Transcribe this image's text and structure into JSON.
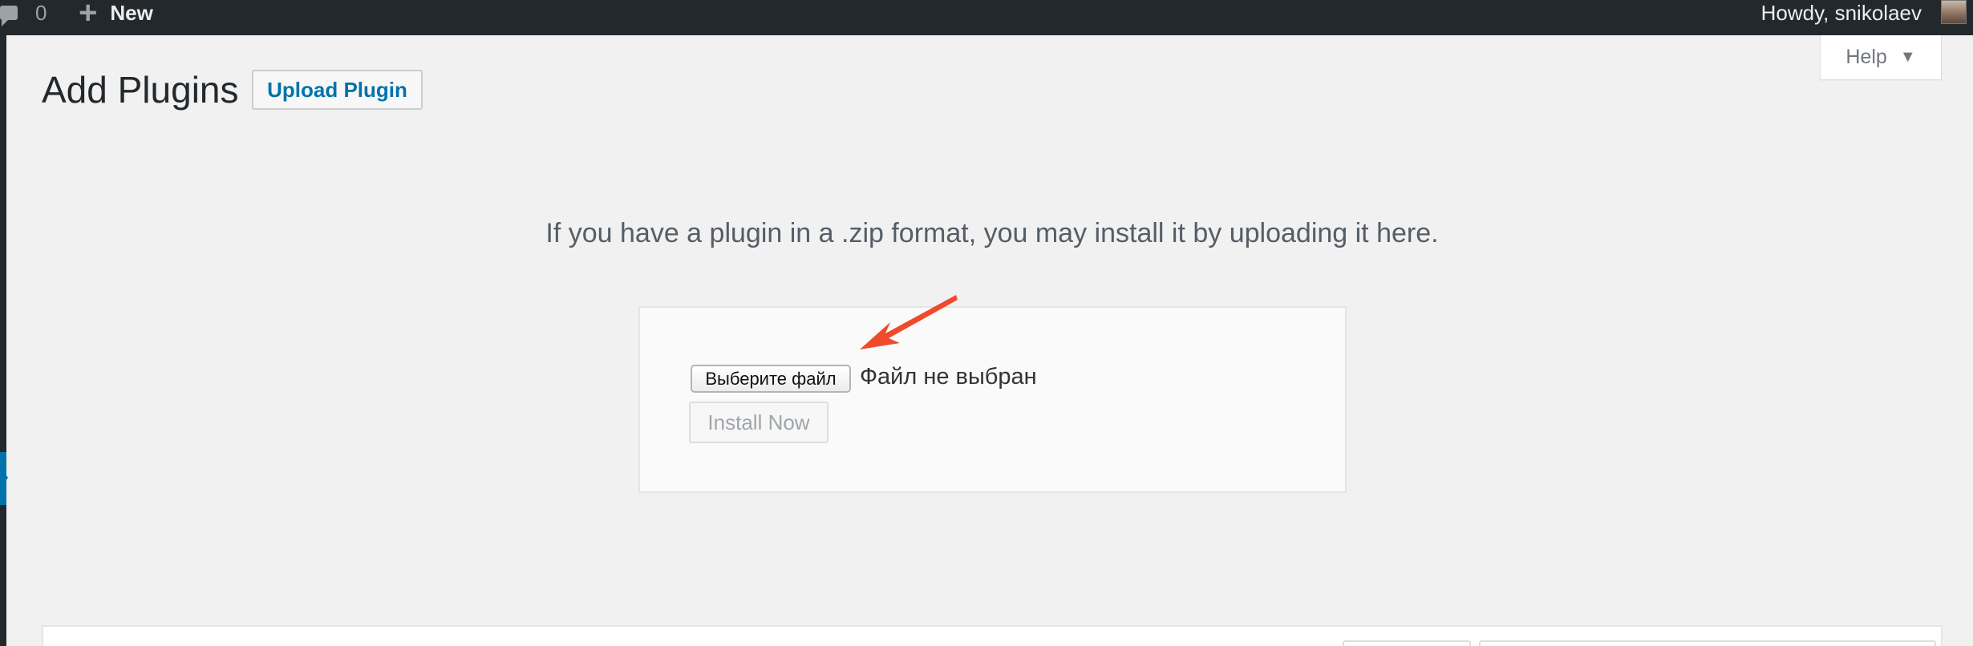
{
  "adminbar": {
    "comments_count": "0",
    "new_label": "New",
    "howdy_text": "Howdy, snikolaev",
    "icons": [
      "comment-icon",
      "plus-icon",
      "avatar"
    ]
  },
  "help": {
    "label": "Help",
    "caret": "▼"
  },
  "page": {
    "title": "Add Plugins",
    "upload_button": "Upload Plugin"
  },
  "upload": {
    "help_text": "If you have a plugin in a .zip format, you may install it by uploading it here.",
    "file_button": "Выберите файл",
    "file_status": "Файл не выбран",
    "install_button": "Install Now"
  },
  "colors": {
    "adminbar_bg": "#23282d",
    "accent": "#0073aa",
    "page_bg": "#f1f1f1",
    "annotation_arrow": "#f04a2c"
  }
}
